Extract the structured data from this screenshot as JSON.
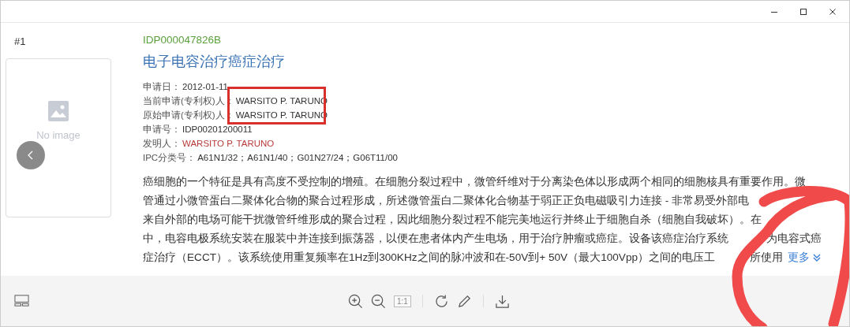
{
  "record": {
    "index": "#1",
    "image_placeholder": "No image",
    "id": "IDP000047826B",
    "title": "电子电容治疗癌症治疗",
    "fields": [
      {
        "label": "申请日：",
        "value": "2012-01-11",
        "kind": "plain"
      },
      {
        "label": "当前申请(专利权)人：",
        "value": "WARSITO P. TARUNO",
        "kind": "plain"
      },
      {
        "label": "原始申请(专利权)人：",
        "value": "WARSITO P. TARUNO",
        "kind": "plain"
      },
      {
        "label": "申请号：",
        "value": "IDP00201200011",
        "kind": "plain"
      },
      {
        "label": "发明人：",
        "value": "WARSITO P. TARUNO",
        "kind": "link"
      },
      {
        "label": "IPC分类号：",
        "value": "A61N1/32；A61N1/40；G01N27/24；G06T11/00",
        "kind": "plain"
      }
    ],
    "abstract_lines": [
      [
        "癌细胞的一个特征是具有高度不受控制的增殖。在细胞分裂过程中，微管纤维对于分离染色体以形成两个相同的细胞核具有重要作用。微"
      ],
      [
        "管通过小微管蛋白二聚体化合物的聚合过程形成，所述微管蛋白二聚体化合物基于弱正正负电磁吸引力连接 - 非常易受外部电"
      ],
      [
        "来自外部的电场可能干扰微管纤维形成的聚合过程，因此细胞分裂过程不能完美地运行并终止于细胞自杀（细胞自我破坏）。在"
      ],
      [
        "中，电容电极系统安装在服装中并连接到振荡器，以便在患者体内产生电场，用于治疗肿瘤或癌症。设备该癌症治疗系统",
        "为电容式癌"
      ],
      [
        "症治疗（ECCT）。该系统使用重复频率在1Hz到300KHz之间的脉冲波和在-50V到+ 50V（最大100Vpp）之间的电压工",
        "所使用"
      ]
    ],
    "more": "更多"
  },
  "toolbar": {
    "actual_size": {
      "label": "1:1",
      "disabled": true
    }
  },
  "annotations": [
    {
      "kind": "rectangle",
      "color": "#d9302c"
    },
    {
      "kind": "scribble",
      "color": "#f04a4a"
    }
  ]
}
